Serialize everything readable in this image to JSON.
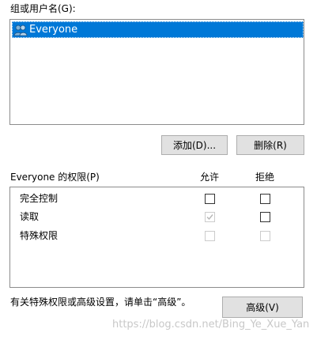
{
  "groups": {
    "label": "组或用户名(G):",
    "items": [
      {
        "name": "Everyone",
        "icon": "users-icon",
        "selected": true
      }
    ]
  },
  "buttons": {
    "add": "添加(D)...",
    "remove": "删除(R)",
    "advanced": "高级(V)"
  },
  "permissions": {
    "header": "Everyone 的权限(P)",
    "allow_header": "允许",
    "deny_header": "拒绝",
    "rows": [
      {
        "name": "完全控制",
        "allow": false,
        "allow_disabled": false,
        "deny": false,
        "deny_disabled": false
      },
      {
        "name": "读取",
        "allow": true,
        "allow_disabled": true,
        "deny": false,
        "deny_disabled": false
      },
      {
        "name": "特殊权限",
        "allow": false,
        "allow_disabled": true,
        "deny": false,
        "deny_disabled": true
      }
    ]
  },
  "footer": {
    "hint": "有关特殊权限或高级设置，请单击“高级”。"
  },
  "watermark": "https://blog.csdn.net/Bing_Ye_Xue_Yan",
  "colors": {
    "selection": "#0078d7",
    "button_bg": "#e1e1e1",
    "border": "#8c8c8c"
  }
}
